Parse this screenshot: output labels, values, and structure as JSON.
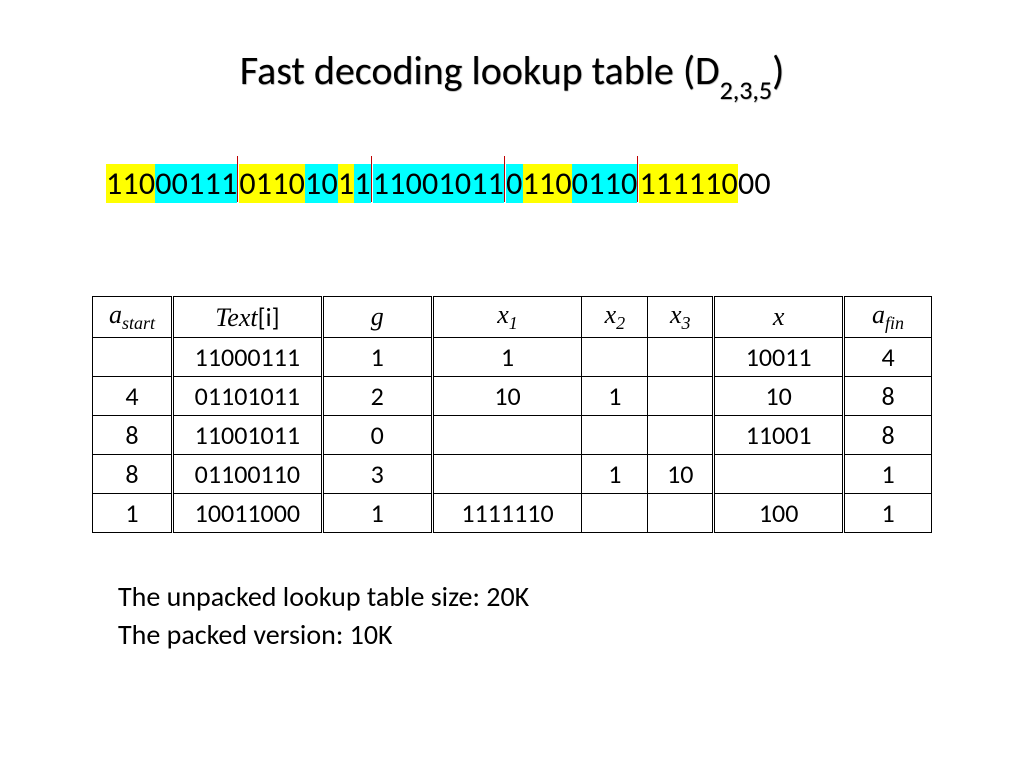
{
  "title": {
    "prefix": "Fast decoding lookup table (D",
    "subscript": "2,3,5",
    "suffix": ")"
  },
  "bits": {
    "segments": [
      {
        "text": "110",
        "hl": "y"
      },
      {
        "text": "00111",
        "hl": "c"
      },
      {
        "sep": true
      },
      {
        "text": "0110",
        "hl": "y"
      },
      {
        "text": "10",
        "hl": "c"
      },
      {
        "text": "1",
        "hl": "y"
      },
      {
        "text": "1",
        "hl": "c"
      },
      {
        "sep": true
      },
      {
        "text": "11001011",
        "hl": "c"
      },
      {
        "sep": true
      },
      {
        "text": "0",
        "hl": "c"
      },
      {
        "text": "110",
        "hl": "y"
      },
      {
        "text": "0110",
        "hl": "c"
      },
      {
        "sep": true
      },
      {
        "text": "111110",
        "hl": "y"
      },
      {
        "text": "00",
        "hl": "n"
      }
    ]
  },
  "table": {
    "headers": {
      "astart_a": "a",
      "astart_sub": "start",
      "text_i": "Text",
      "text_br": "[i]",
      "g": "g",
      "x1_a": "x",
      "x1_sub": "1",
      "x2_a": "x",
      "x2_sub": "2",
      "x3_a": "x",
      "x3_sub": "3",
      "x": "x",
      "afin_a": "a",
      "afin_sub": "fin"
    },
    "rows": [
      {
        "astart": "",
        "text": "11000111",
        "g": "1",
        "x1": "1",
        "x2": "",
        "x3": "",
        "x": "10011",
        "afin": "4"
      },
      {
        "astart": "4",
        "text": "01101011",
        "g": "2",
        "x1": "10",
        "x2": "1",
        "x3": "",
        "x": "10",
        "afin": "8"
      },
      {
        "astart": "8",
        "text": "11001011",
        "g": "0",
        "x1": "",
        "x2": "",
        "x3": "",
        "x": "11001",
        "afin": "8"
      },
      {
        "astart": "8",
        "text": "01100110",
        "g": "3",
        "x1": "",
        "x2": "1",
        "x3": "10",
        "x": "",
        "afin": "1"
      },
      {
        "astart": "1",
        "text": "10011000",
        "g": "1",
        "x1": "1111110",
        "x2": "",
        "x3": "",
        "x": "100",
        "afin": "1"
      }
    ]
  },
  "notes": {
    "line1": "The unpacked lookup table size: 20K",
    "line2": "The packed version: 10K"
  }
}
